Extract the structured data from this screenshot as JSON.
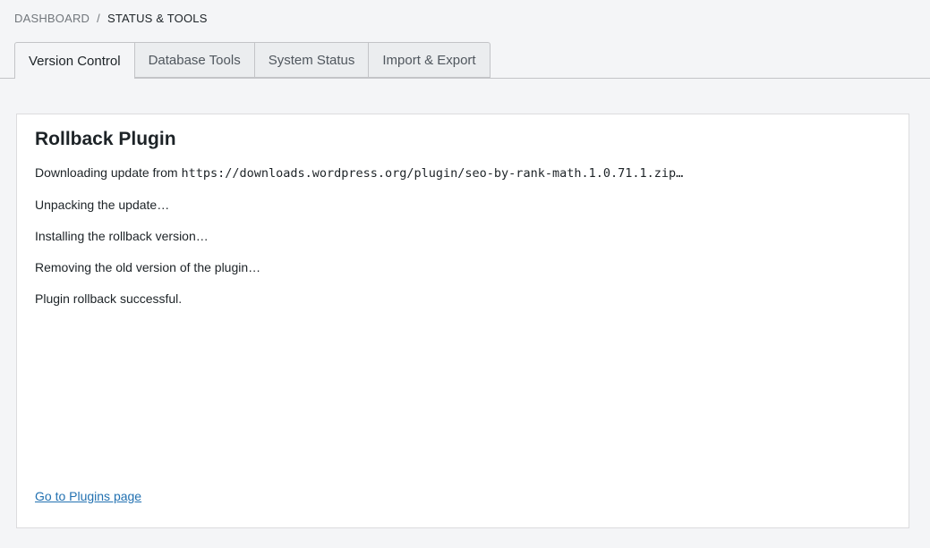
{
  "breadcrumb": {
    "parent": "DASHBOARD",
    "separator": "/",
    "current": "STATUS & TOOLS"
  },
  "tabs": [
    {
      "label": "Version Control",
      "active": true
    },
    {
      "label": "Database Tools",
      "active": false
    },
    {
      "label": "System Status",
      "active": false
    },
    {
      "label": "Import & Export",
      "active": false
    }
  ],
  "panel": {
    "title": "Rollback Plugin",
    "download_prefix": "Downloading update from",
    "download_url": "https://downloads.wordpress.org/plugin/seo-by-rank-math.1.0.71.1.zip…",
    "steps": [
      "Unpacking the update…",
      "Installing the rollback version…",
      "Removing the old version of the plugin…",
      "Plugin rollback successful."
    ],
    "link_label": "Go to Plugins page"
  },
  "colors": {
    "background": "#f4f5f7",
    "panel": "#ffffff",
    "link": "#2271b1",
    "border": "#c3c4c7"
  }
}
